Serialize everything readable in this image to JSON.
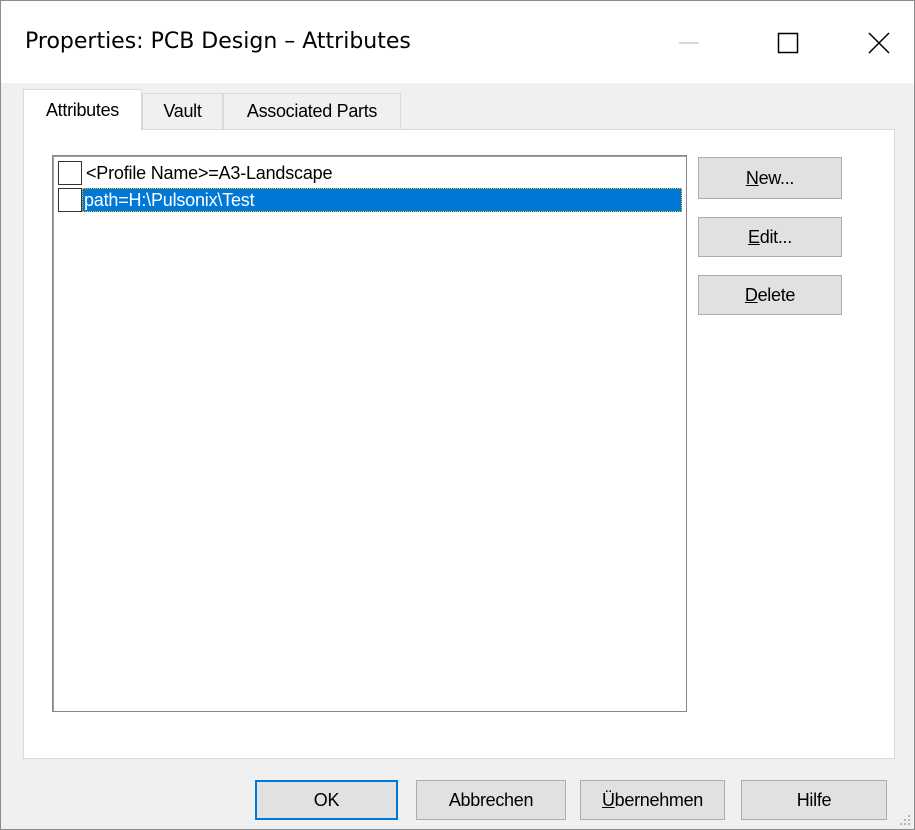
{
  "window": {
    "title": "Properties: PCB Design – Attributes",
    "controls": {
      "minimize_icon": "minimize-icon",
      "maximize_icon": "maximize-icon",
      "close_icon": "close-icon"
    }
  },
  "tabs": [
    {
      "label": "Attributes",
      "active": true
    },
    {
      "label": "Vault",
      "active": false
    },
    {
      "label": "Associated Parts",
      "active": false
    }
  ],
  "attributes": {
    "items": [
      {
        "text": "<Profile Name>=A3-Landscape",
        "checked": false,
        "selected": false
      },
      {
        "text": "path=H:\\Pulsonix\\Test",
        "checked": false,
        "selected": true
      }
    ],
    "buttons": {
      "new": {
        "mnemonic": "N",
        "rest": "ew..."
      },
      "edit": {
        "mnemonic": "E",
        "rest": "dit..."
      },
      "delete": {
        "mnemonic": "D",
        "rest": "elete"
      }
    }
  },
  "footer": {
    "ok": "OK",
    "cancel": "Abbrechen",
    "apply": {
      "mnemonic": "Ü",
      "rest": "bernehmen"
    },
    "help": "Hilfe"
  },
  "colors": {
    "selection": "#0078d7",
    "focus_border": "#0078d7",
    "dialog_bg": "#f0f0f0",
    "button_bg": "#e1e1e1"
  }
}
